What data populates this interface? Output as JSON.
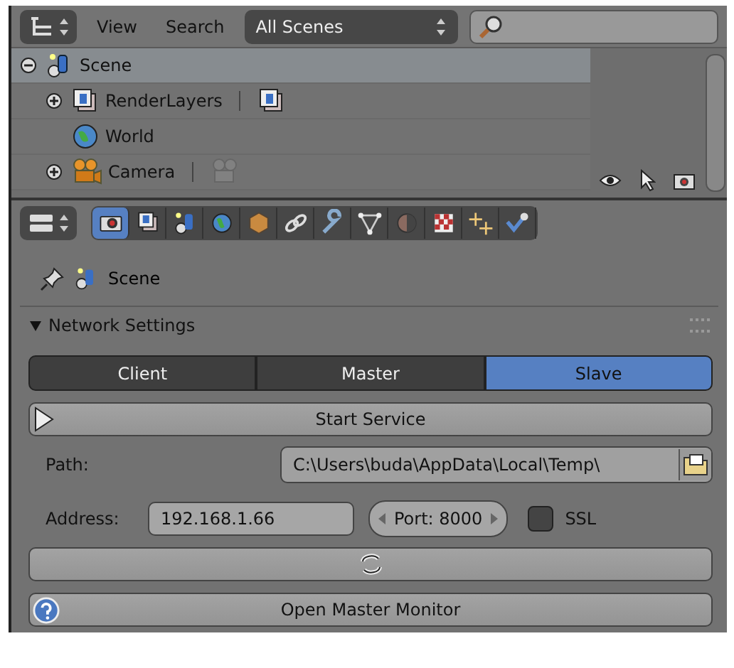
{
  "outliner": {
    "menus": [
      "View",
      "Search"
    ],
    "scene_filter": "All Scenes",
    "tree": [
      {
        "kind": "scene",
        "label": "Scene",
        "selected": true,
        "expanded": true,
        "children": [
          {
            "kind": "render_layers",
            "label": "RenderLayers",
            "selected": false,
            "expanded": false,
            "linked": true
          },
          {
            "kind": "world",
            "label": "World",
            "selected": false,
            "linked": false
          },
          {
            "kind": "camera",
            "label": "Camera",
            "selected": false,
            "expanded": false,
            "linked": true
          }
        ]
      }
    ]
  },
  "properties": {
    "tabs": [
      {
        "kind": "render",
        "selected": true
      },
      {
        "kind": "render_layers",
        "selected": false
      },
      {
        "kind": "scene",
        "selected": false
      },
      {
        "kind": "world",
        "selected": false
      },
      {
        "kind": "object",
        "selected": false
      },
      {
        "kind": "constraints",
        "selected": false
      },
      {
        "kind": "modifiers",
        "selected": false
      },
      {
        "kind": "data",
        "selected": false
      },
      {
        "kind": "material",
        "selected": false
      },
      {
        "kind": "texture",
        "selected": false
      },
      {
        "kind": "particles",
        "selected": false
      },
      {
        "kind": "physics",
        "selected": false
      }
    ],
    "context": "Scene",
    "panel": {
      "title": "Network Settings",
      "expanded": true,
      "modes": [
        {
          "label": "Client",
          "selected": false
        },
        {
          "label": "Master",
          "selected": false
        },
        {
          "label": "Slave",
          "selected": true
        }
      ],
      "start_button": "Start Service",
      "path": {
        "label": "Path:",
        "value": "C:\\Users\\buda\\AppData\\Local\\Temp\\"
      },
      "address": {
        "label": "Address:",
        "value": "192.168.1.66"
      },
      "port": "Port: 8000",
      "ssl": {
        "label": "SSL",
        "checked": false
      },
      "monitor_button": "Open Master Monitor"
    }
  }
}
